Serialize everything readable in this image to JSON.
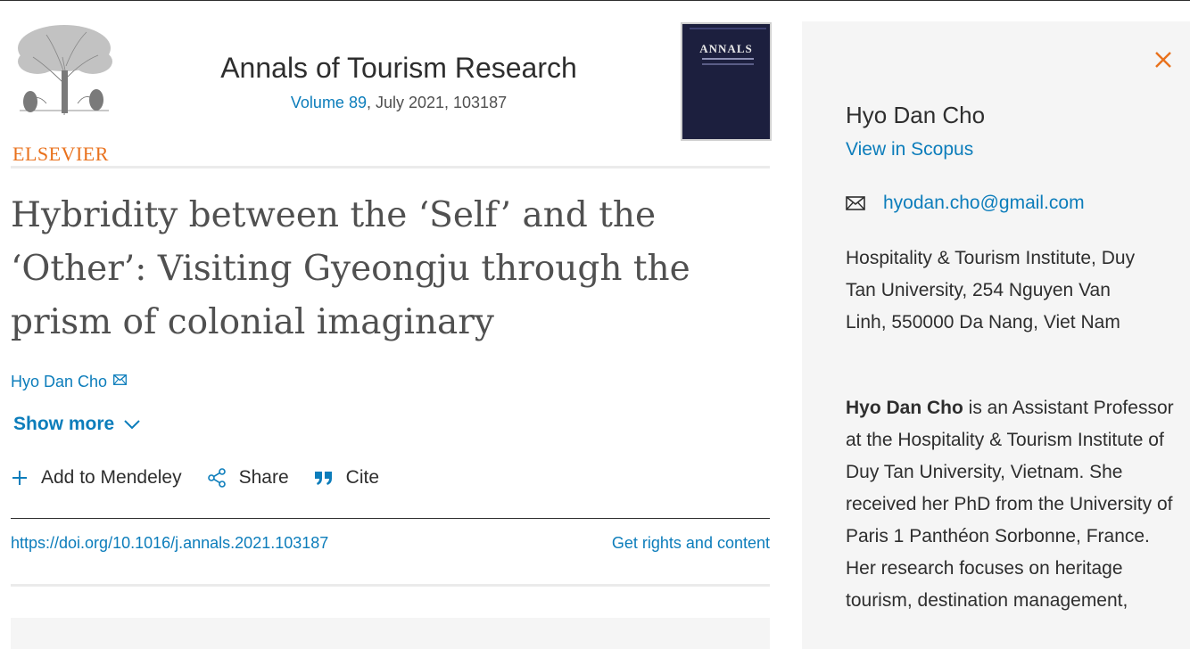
{
  "publisher": {
    "logo_text": "ELSEVIER"
  },
  "journal": {
    "title": "Annals of Tourism Research",
    "volume_link": "Volume 89",
    "issue_info": ", July 2021, 103187",
    "cover_title": "ANNALS"
  },
  "article": {
    "title": "Hybridity between the ‘Self’ and the ‘Other’: Visiting Gyeongju through the prism of colonial imaginary",
    "author": "Hyo Dan Cho",
    "show_more": "Show more",
    "actions": {
      "mendeley": "Add to Mendeley",
      "share": "Share",
      "cite": "Cite"
    },
    "doi": "https://doi.org/10.1016/j.annals.2021.103187",
    "rights": "Get rights and content"
  },
  "author_panel": {
    "name": "Hyo Dan Cho",
    "scopus_link": "View in Scopus",
    "email": "hyodan.cho@gmail.com",
    "affiliation": "Hospitality & Tourism Institute, Duy Tan University, 254 Nguyen Van Linh, 550000 Da Nang, Viet Nam",
    "bio_name": "Hyo Dan Cho",
    "bio_text": " is an Assistant Professor at the Hospitality & Tourism Institute of Duy Tan University, Vietnam. She received her PhD from the University of Paris 1 Panthéon Sorbonne, France. Her research focuses on heritage tourism, destination management,"
  },
  "colors": {
    "link": "#0c7dbb",
    "accent_orange": "#e9711c",
    "panel_bg": "#f5f5f5",
    "text": "#2e2e2e"
  }
}
